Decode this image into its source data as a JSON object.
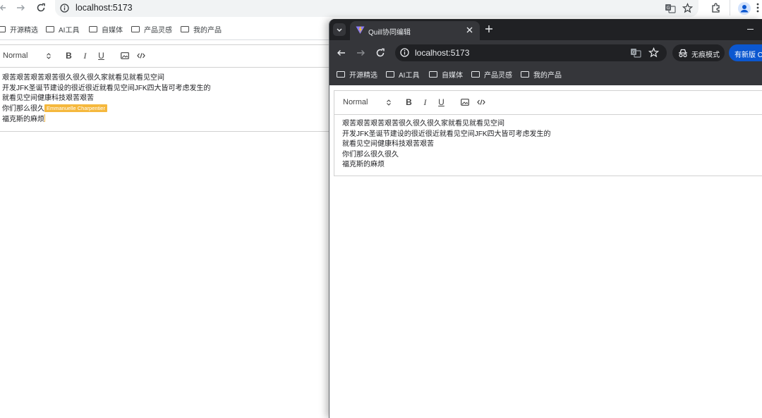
{
  "background_window": {
    "url": "localhost:5173",
    "bookmarks": [
      "开源精选",
      "AI工具",
      "自媒体",
      "产品灵感",
      "我的产品"
    ],
    "toolbar": {
      "format": "Normal",
      "bold": "B",
      "italic": "I",
      "underline": "U"
    },
    "editor_lines": [
      "艰苦艰苦艰苦艰苦很久很久很久家就看见就看见空间",
      "开发JFK圣诞节建设的很近很近就看见空间JFK四大皆可考虑发生的",
      "就看见空间健康科技艰苦艰苦",
      "你们那么很久",
      "福克斯的麻烦"
    ],
    "remote_cursor_name": "Emmanuelle Charpentier"
  },
  "foreground_window": {
    "tab_title": "Quill协同编辑",
    "url": "localhost:5173",
    "incognito_label": "无痕模式",
    "update_label": "有新版 Ch",
    "bookmarks": [
      "开源精选",
      "AI工具",
      "自媒体",
      "产品灵感",
      "我的产品"
    ],
    "toolbar": {
      "format": "Normal",
      "bold": "B",
      "italic": "I",
      "underline": "U"
    },
    "editor_lines": [
      "艰苦艰苦艰苦艰苦很久很久很久家就看见就看见空间",
      "开发JFK圣诞节建设的很近很近就看见空间JFK四大皆可考虑发生的",
      "就看见空间健康科技艰苦艰苦",
      "你们那么很久很久",
      "福克斯的麻烦"
    ]
  },
  "colors": {
    "cursor_flag": "#f5b83d",
    "dark_frame": "#35363a",
    "update_button": "#0b57d0"
  }
}
